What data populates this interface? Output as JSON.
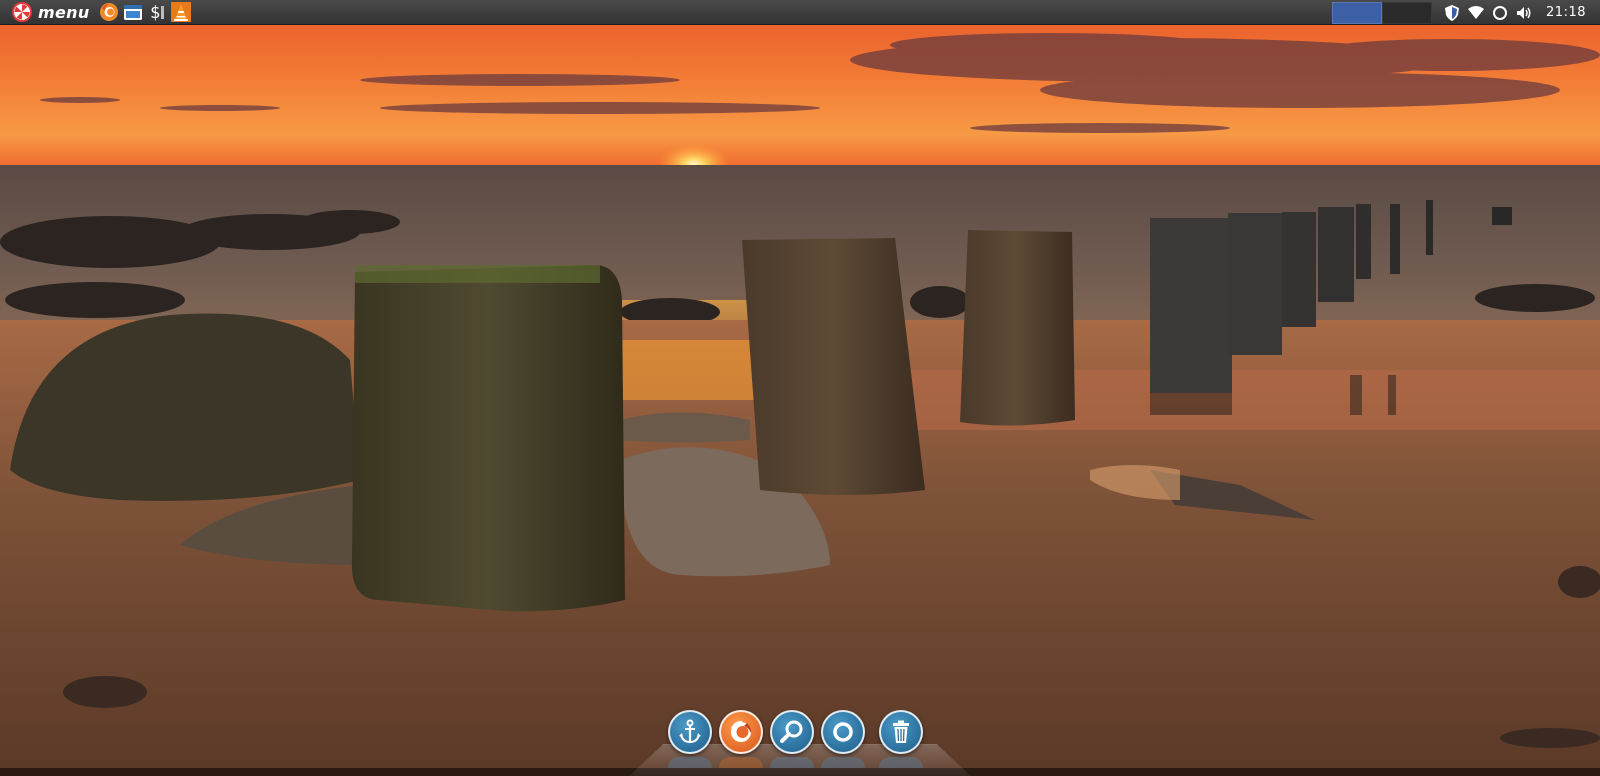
{
  "panel": {
    "menu_label": "menu",
    "clock": "21:18",
    "launchers": [
      {
        "icon": "firefox-icon"
      },
      {
        "icon": "file-manager-icon"
      },
      {
        "icon": "terminal-icon"
      },
      {
        "icon": "vlc-icon"
      }
    ],
    "workspaces": [
      {
        "active": true
      },
      {
        "active": false
      }
    ],
    "tray_icons": [
      "shield-icon",
      "wifi-icon",
      "circle-icon",
      "volume-icon"
    ]
  },
  "dock": {
    "items": [
      {
        "icon": "anchor-icon"
      },
      {
        "icon": "firefox-icon"
      },
      {
        "icon": "search-icon"
      },
      {
        "icon": "ring-icon"
      },
      {
        "icon": "trash-icon"
      }
    ]
  },
  "colors": {
    "panel": "#3b3b3b",
    "workspace_active": "#3d5fa6",
    "dock_blue": "#2a6f9f",
    "dock_orange": "#e86a2a"
  }
}
